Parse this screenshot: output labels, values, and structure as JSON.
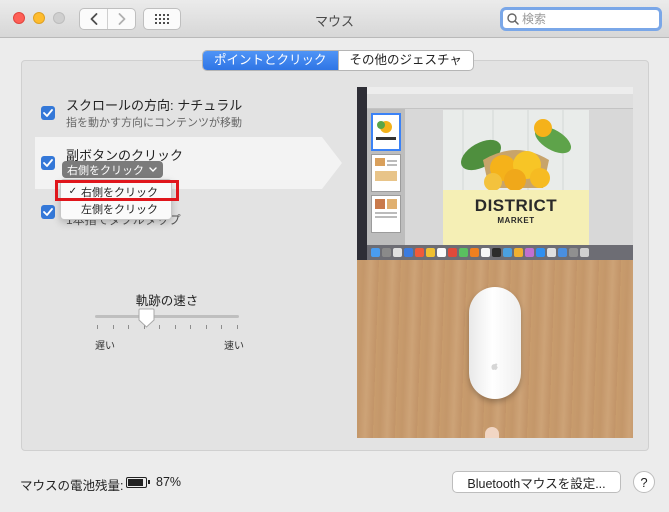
{
  "window": {
    "title": "マウス",
    "search_placeholder": "検索"
  },
  "tabs": [
    {
      "label": "ポイントとクリック",
      "active": true
    },
    {
      "label": "その他のジェスチャ",
      "active": false
    }
  ],
  "options": {
    "scroll": {
      "label": "スクロールの方向: ナチュラル",
      "description": "指を動かす方向にコンテンツが移動",
      "checked": true
    },
    "secondary_click": {
      "label": "副ボタンのクリック",
      "checked": true,
      "selected": "右側をクリック"
    },
    "smart_zoom": {
      "label": "1本指でダブルタップ",
      "checked": true
    }
  },
  "secondary_click_menu": {
    "items": [
      {
        "label": "右側をクリック",
        "checked": true
      },
      {
        "label": "左側をクリック",
        "checked": false
      }
    ]
  },
  "tracking_speed": {
    "title": "軌跡の速さ",
    "min_label": "遅い",
    "max_label": "速い",
    "value_fraction": 0.35
  },
  "preview": {
    "document_title": "DISTRICT",
    "document_subtitle": "MARKET"
  },
  "battery": {
    "label": "マウスの電池残量:",
    "percent_text": "87%",
    "level": 0.87
  },
  "buttons": {
    "bluetooth": "Bluetoothマウスを設定...",
    "help": "?"
  },
  "colors": {
    "accent": "#3478d8",
    "highlight_box": "#e0161c"
  }
}
